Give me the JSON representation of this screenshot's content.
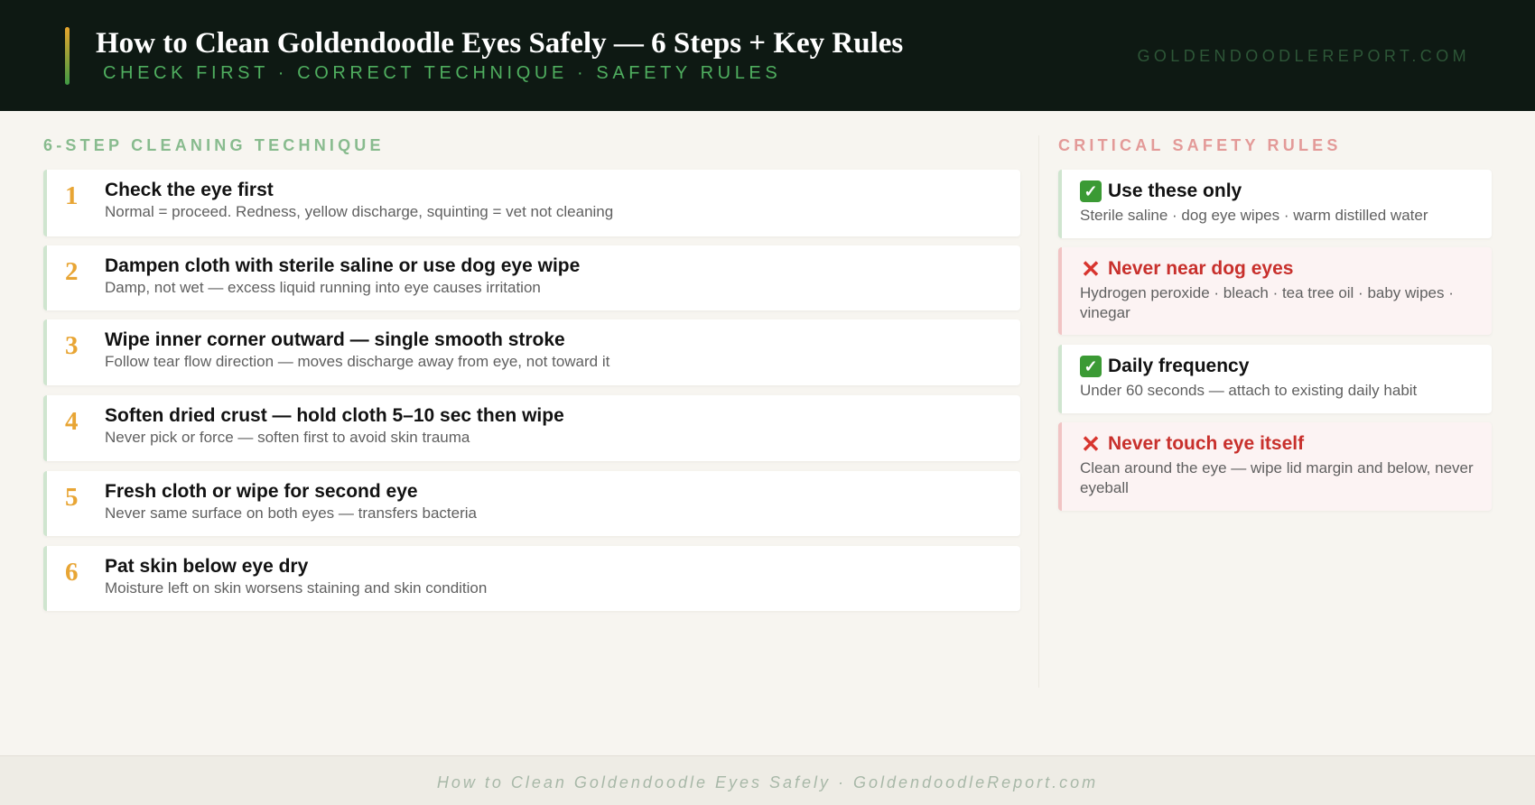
{
  "header": {
    "title": "How to Clean Goldendoodle Eyes Safely — 6 Steps + Key Rules",
    "subtitle": "CHECK FIRST · CORRECT TECHNIQUE · SAFETY RULES",
    "site": "GOLDENDOODLEREPORT.COM"
  },
  "steps_section": {
    "title": "6-STEP CLEANING TECHNIQUE",
    "steps": [
      {
        "num": "1",
        "title": "Check the eye first",
        "desc": "Normal = proceed. Redness, yellow discharge, squinting = vet not cleaning"
      },
      {
        "num": "2",
        "title": "Dampen cloth with sterile saline or use dog eye wipe",
        "desc": "Damp, not wet — excess liquid running into eye causes irritation"
      },
      {
        "num": "3",
        "title": "Wipe inner corner outward — single smooth stroke",
        "desc": "Follow tear flow direction — moves discharge away from eye, not toward it"
      },
      {
        "num": "4",
        "title": "Soften dried crust — hold cloth 5–10 sec then wipe",
        "desc": "Never pick or force — soften first to avoid skin trauma"
      },
      {
        "num": "5",
        "title": "Fresh cloth or wipe for second eye",
        "desc": "Never same surface on both eyes — transfers bacteria"
      },
      {
        "num": "6",
        "title": "Pat skin below eye dry",
        "desc": "Moisture left on skin worsens staining and skin condition"
      }
    ]
  },
  "rules_section": {
    "title": "CRITICAL SAFETY RULES",
    "rules": [
      {
        "type": "ok",
        "icon": "check-icon",
        "glyph": "✓",
        "title": "Use these only",
        "desc": "Sterile saline · dog eye wipes · warm distilled water"
      },
      {
        "type": "bad",
        "icon": "cross-icon",
        "glyph": "✕",
        "title": "Never near dog eyes",
        "desc": "Hydrogen peroxide · bleach · tea tree oil · baby wipes · vinegar"
      },
      {
        "type": "ok",
        "icon": "check-icon",
        "glyph": "✓",
        "title": "Daily frequency",
        "desc": "Under 60 seconds — attach to existing daily habit"
      },
      {
        "type": "bad",
        "icon": "cross-icon",
        "glyph": "✕",
        "title": "Never touch eye itself",
        "desc": "Clean around the eye — wipe lid margin and below, never eyeball"
      }
    ]
  },
  "footer": {
    "text": "How to Clean Goldendoodle Eyes Safely · GoldendoodleReport.com"
  },
  "colors": {
    "header_bg": "#0e1913",
    "accent_green": "#4fae5f",
    "accent_orange": "#e8a534",
    "danger_red": "#c8302c"
  }
}
